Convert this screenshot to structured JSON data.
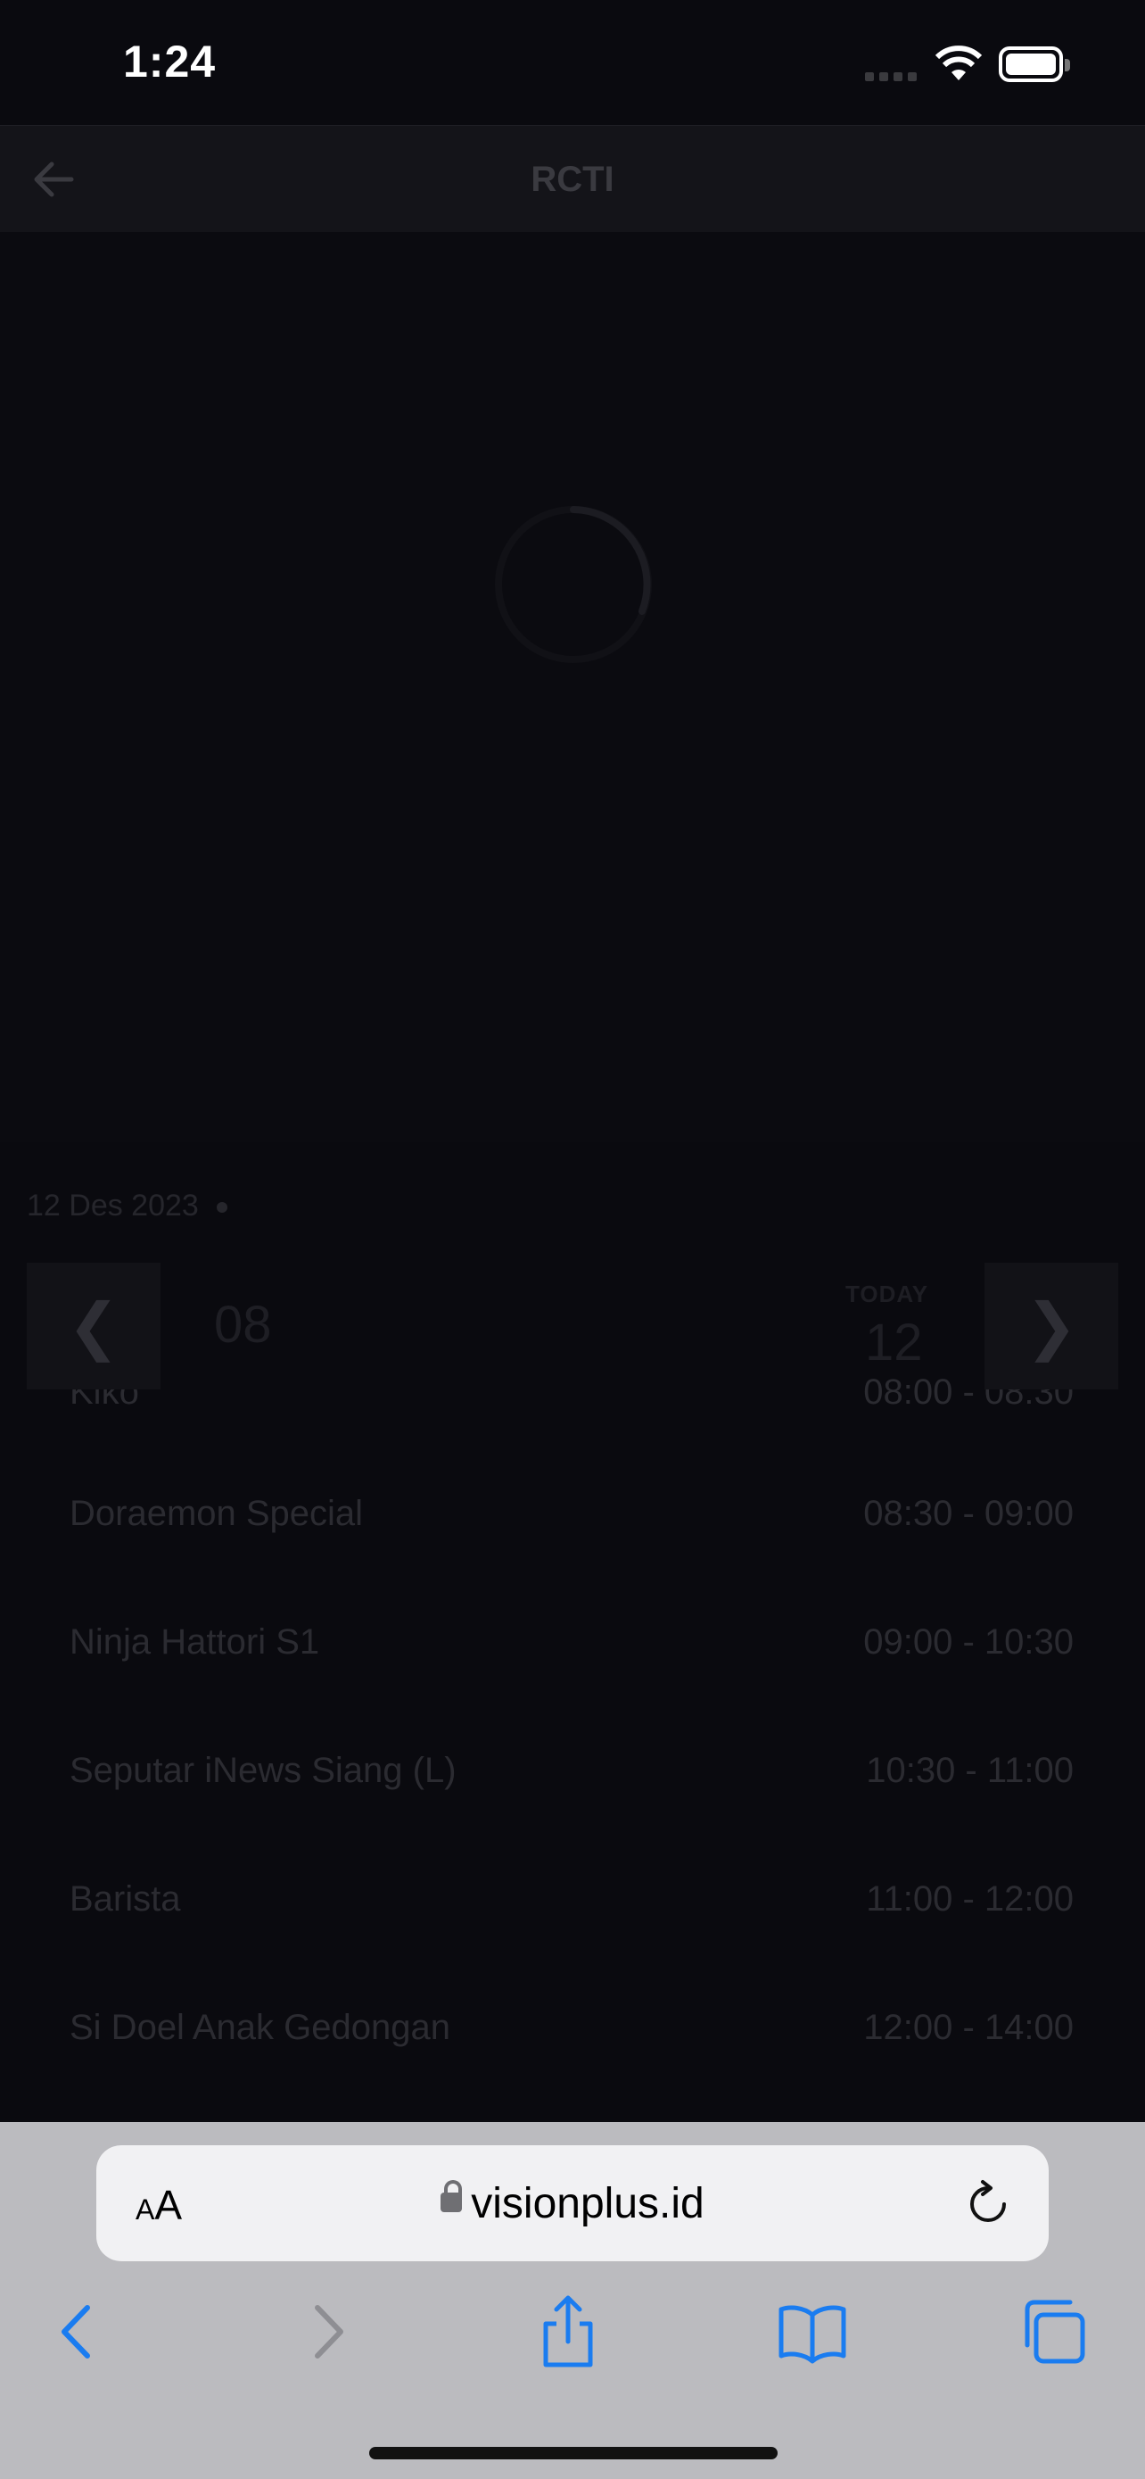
{
  "status_bar": {
    "time": "1:24"
  },
  "header": {
    "title": "RCTI"
  },
  "schedule_date": "12 Des 2023",
  "day_strip": {
    "prev_day": "08",
    "today_label": "TODAY",
    "today_day": "12"
  },
  "programs": [
    {
      "title": "Kiko",
      "time": "08:00 - 08:30"
    },
    {
      "title": "Doraemon Special",
      "time": "08:30 - 09:00"
    },
    {
      "title": "Ninja Hattori S1",
      "time": "09:00 - 10:30"
    },
    {
      "title": "Seputar iNews Siang (L)",
      "time": "10:30 - 11:00"
    },
    {
      "title": "Barista",
      "time": "11:00 - 12:00"
    },
    {
      "title": "Si Doel Anak Gedongan",
      "time": "12:00 - 14:00"
    }
  ],
  "browser": {
    "text_size_label": "AA",
    "url": "visionplus.id"
  },
  "colors": {
    "accent": "#1a7cf0",
    "background": "#0a0a0f"
  }
}
